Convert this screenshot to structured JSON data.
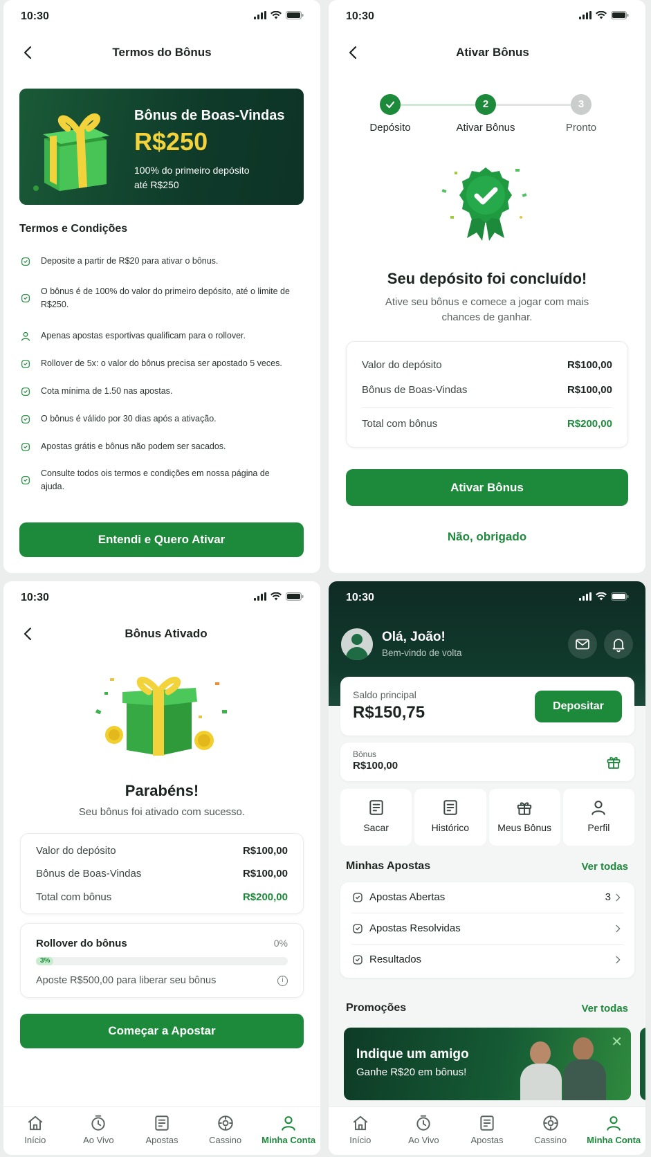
{
  "status_time": "10:30",
  "colors": {
    "brand_green": "#1c8a3a",
    "dark_green": "#0f3b2b",
    "gold": "#f3d33b"
  },
  "terms_screen": {
    "title": "Termos do Bônus",
    "banner": {
      "heading": "Bônus de Boas-Vindas",
      "amount": "R$250",
      "description_line1": "100% do primeiro depósito",
      "description_line2": "até R$250"
    },
    "section_title": "Termos e Condições",
    "items": [
      {
        "icon": "badge-icon",
        "text": "Deposite a partir de R$20 para ativar o bônus."
      },
      {
        "icon": "percent-icon",
        "text": "O bônus é de 100% do valor do primeiro depósito, até o limite de R$250."
      },
      {
        "icon": "user-icon",
        "text": "Apenas apostas esportivas qualificam para o rollover."
      },
      {
        "icon": "checklist-icon",
        "text": "Rollover de 5x: o valor do bônus precisa ser apostado 5 veces."
      },
      {
        "icon": "odds-icon",
        "text": "Cota mínima de 1.50 nas apostas."
      },
      {
        "icon": "lock-icon",
        "text": "O bônus é válido por 30 dias após a ativação."
      },
      {
        "icon": "shield-icon",
        "text": "Apostas grátis e bônus não podem ser sacados."
      },
      {
        "icon": "help-icon",
        "text": "Consulte todos ois termos e condições em nossa página de ajuda."
      }
    ],
    "cta": "Entendi e Quero Ativar"
  },
  "activate_screen": {
    "title": "Ativar Bônus",
    "steps": [
      {
        "number": "",
        "label": "Depósito"
      },
      {
        "number": "2",
        "label": "Ativar Bônus"
      },
      {
        "number": "3",
        "label": "Pronto"
      }
    ],
    "heading": "Seu depósito foi concluído!",
    "subtitle_line1": "Ative seu bônus e comece a jogar com mais",
    "subtitle_line2": "chances de ganhar.",
    "summary": [
      {
        "label": "Valor do depósito",
        "value": "R$100,00"
      },
      {
        "label": "Bônus de Boas-Vindas",
        "value": "R$100,00"
      },
      {
        "label": "Total com bônus",
        "value": "R$200,00"
      }
    ],
    "cta": "Ativar Bônus",
    "secondary": "Não, obrigado"
  },
  "activated_screen": {
    "title": "Bônus Ativado",
    "heading": "Parabéns!",
    "subtitle": "Seu bônus foi ativado com sucesso.",
    "summary": [
      {
        "label": "Valor do depósito",
        "value": "R$100,00"
      },
      {
        "label": "Bônus de Boas-Vindas",
        "value": "R$100,00"
      },
      {
        "label": "Total com bônus",
        "value": "R$200,00"
      }
    ],
    "rollover": {
      "title": "Rollover do bônus",
      "percent": "0%",
      "bar_label": "3%",
      "progress": 0.03,
      "hint": "Aposte R$500,00 para liberar seu bônus"
    },
    "cta": "Começar a Apostar"
  },
  "account_screen": {
    "greeting": "Olá, João!",
    "welcome": "Bem-vindo de volta",
    "balance_label": "Saldo principal",
    "balance_value": "R$150,75",
    "deposit_button": "Depositar",
    "bonus_label": "Bônus",
    "bonus_value": "R$100,00",
    "quick_actions": [
      {
        "icon": "wallet-icon",
        "label": "Sacar"
      },
      {
        "icon": "history-icon",
        "label": "Histórico"
      },
      {
        "icon": "gift-icon",
        "label": "Meus Bônus"
      },
      {
        "icon": "profile-icon",
        "label": "Perfil"
      }
    ],
    "bets_title": "Minhas Apostas",
    "see_all": "Ver todas",
    "bets": [
      {
        "label": "Apostas Abertas",
        "count": "3"
      },
      {
        "label": "Apostas Resolvidas",
        "count": ""
      },
      {
        "label": "Resultados",
        "count": ""
      }
    ],
    "promos_title": "Promoções",
    "promo_heading": "Indique um amigo",
    "promo_text": "Ganhe R$20 em bônus!"
  },
  "tabbar": [
    {
      "icon": "home-icon",
      "label": "Início"
    },
    {
      "icon": "live-icon",
      "label": "Ao Vivo"
    },
    {
      "icon": "ticket-icon",
      "label": "Apostas"
    },
    {
      "icon": "casino-icon",
      "label": "Cassino"
    },
    {
      "icon": "account-icon",
      "label": "Minha Conta"
    }
  ]
}
